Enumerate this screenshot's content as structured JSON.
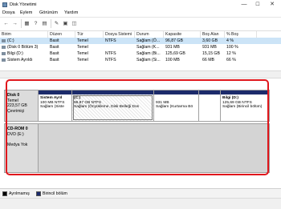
{
  "window": {
    "title": "Disk Yönetimi",
    "min": "—",
    "max": "☐",
    "close": "✕"
  },
  "menu": [
    "Dosya",
    "Eylem",
    "Görünüm",
    "Yardım"
  ],
  "toolbar": {
    "back": "←",
    "forward": "→",
    "b3": "▦",
    "b4": "?",
    "b5": "▤",
    "b6": "✎",
    "b7": "▣",
    "b8": "◫"
  },
  "table": {
    "headers": [
      "Birim",
      "Düzen",
      "Tür",
      "Dosya Sistemi",
      "Durum",
      "Kapasite",
      "Boş Alan",
      "% Boş"
    ],
    "rows": [
      [
        "(C:)",
        "Basit",
        "Temel",
        "NTFS",
        "Sağlam (Ö...",
        "96,87 GB",
        "3,60 GB",
        "4 %"
      ],
      [
        "(Disk 0 Bölüm 3)",
        "Basit",
        "Temel",
        "",
        "Sağlam (K...",
        "931 MB",
        "931 MB",
        "100 %"
      ],
      [
        "Bilgi (D:)",
        "Basit",
        "Temel",
        "NTFS",
        "Sağlam (Bi...",
        "125,69 GB",
        "15,15 GB",
        "12 %"
      ],
      [
        "Sistem Ayrıldı",
        "Basit",
        "Temel",
        "NTFS",
        "Sağlam (Si...",
        "100 MB",
        "66 MB",
        "66 %"
      ]
    ]
  },
  "disk0": {
    "name": "Disk 0",
    "type": "Temel",
    "size": "223,57 GB",
    "status": "Çevrimiçi",
    "partitions": [
      {
        "title": "Sistem Ayrıl",
        "line1": "100 MB NTFS",
        "line2": "Sağlam (Siste"
      },
      {
        "title": "(C:)",
        "line1": "96,87 GB NTFS",
        "line2": "Sağlam (Önyükleme, Disk Belleği Dos"
      },
      {
        "title": "",
        "line1": "931 MB",
        "line2": "Sağlam (Kurtarma Bö"
      },
      {
        "title": "",
        "line1": "",
        "line2": ""
      },
      {
        "title": "Bilgi (D:)",
        "line1": "125,69 GB NTFS",
        "line2": "Sağlam (Birincil bölüm)"
      }
    ]
  },
  "cdrom": {
    "name": "CD-ROM 0",
    "type": "DVD (E:)",
    "status": "Medya Yok"
  },
  "legend": [
    {
      "label": "Ayrılmamış",
      "color": "#000000"
    },
    {
      "label": "Birincil bölüm",
      "color": "#1c2b6b"
    }
  ],
  "colors": {
    "highlight": "#e0171c",
    "partition_bar": "#1c2b6b",
    "selected_row": "#cce4f7"
  }
}
